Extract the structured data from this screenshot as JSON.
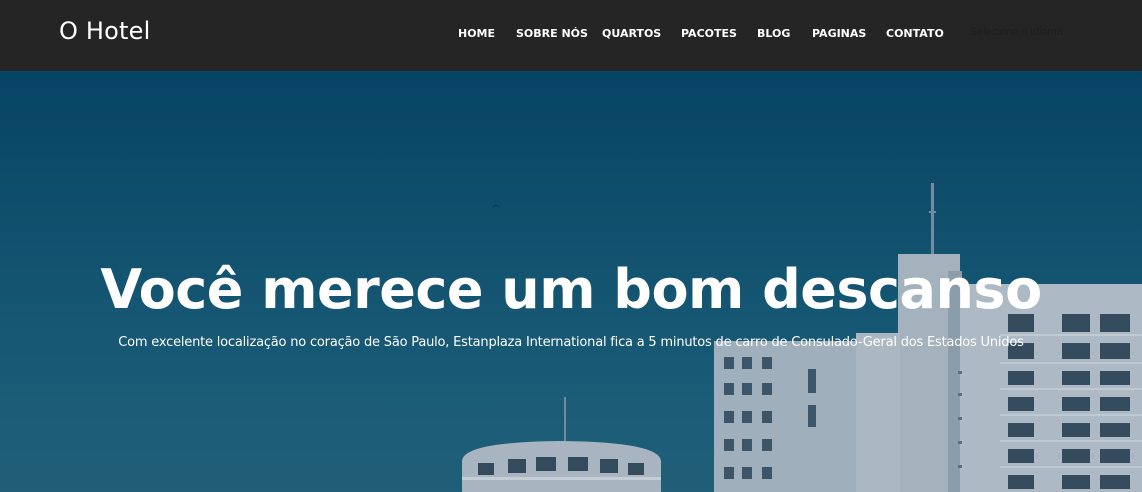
{
  "brand": {
    "name": "O Hotel"
  },
  "nav": {
    "items": [
      {
        "label": "HOME"
      },
      {
        "label": "SOBRE NÓS"
      },
      {
        "label": "QUARTOS"
      },
      {
        "label": "PACOTES"
      },
      {
        "label": "BLOG"
      },
      {
        "label": "PAGINAS"
      },
      {
        "label": "CONTATO"
      }
    ],
    "language_selector": "Selecione o idioma"
  },
  "hero": {
    "title": "Você merece um bom descanso",
    "subtitle": "Com excelente localização no coração de São Paulo, Estanplaza International fica a 5 minutos de carro de Consulado-Geral dos Estados Unidos"
  },
  "colors": {
    "navbar": "#252525",
    "sky": "#135978",
    "building": "#c9d3dc"
  }
}
